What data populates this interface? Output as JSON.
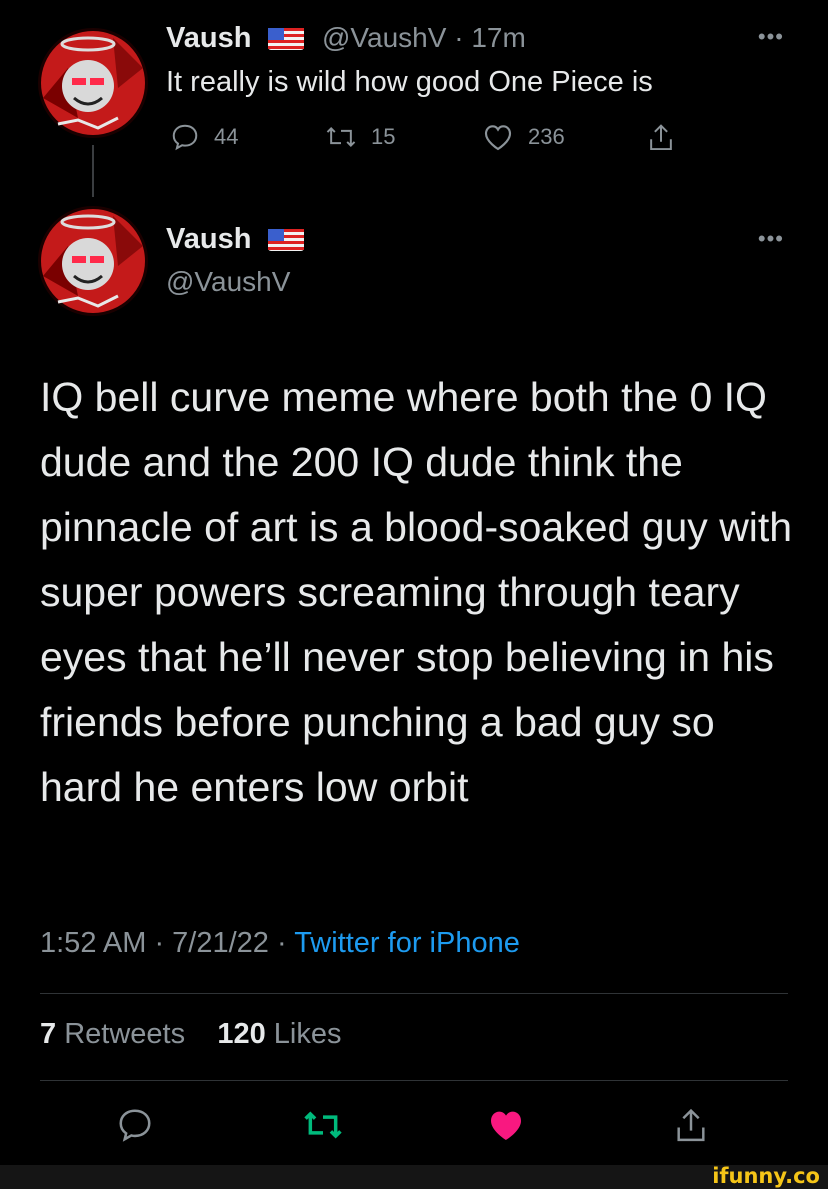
{
  "reply_tweet": {
    "name": "Vaush",
    "handle": "@VaushV",
    "time": "17m",
    "text": "It really is wild how good One Piece is",
    "replies": "44",
    "retweets": "15",
    "likes": "236"
  },
  "main_tweet": {
    "name": "Vaush",
    "handle": "@VaushV",
    "text": "IQ bell curve meme where both the 0 IQ dude and the 200 IQ dude think the pinnacle of art is a blood-soaked guy with super powers screaming through teary eyes that he’ll never stop believing in his friends before punching a bad guy so hard he enters low orbit",
    "timestamp": "1:52 AM · 7/21/22 · ",
    "source": "Twitter for iPhone",
    "retweet_count": "7",
    "retweet_label": "Retweets",
    "like_count": "120",
    "like_label": "Likes"
  },
  "icons": {
    "more": "more-icon",
    "reply": "reply-icon",
    "retweet": "retweet-icon",
    "like": "heart-icon",
    "share": "share-icon",
    "flag": "us-flag-icon"
  },
  "colors": {
    "background": "#000000",
    "text": "#e7e9ea",
    "muted": "#8b9399",
    "link": "#1d9bf0",
    "retweet_active": "#00ba7c",
    "like_active": "#f91880"
  },
  "watermark": "ifunny.co"
}
